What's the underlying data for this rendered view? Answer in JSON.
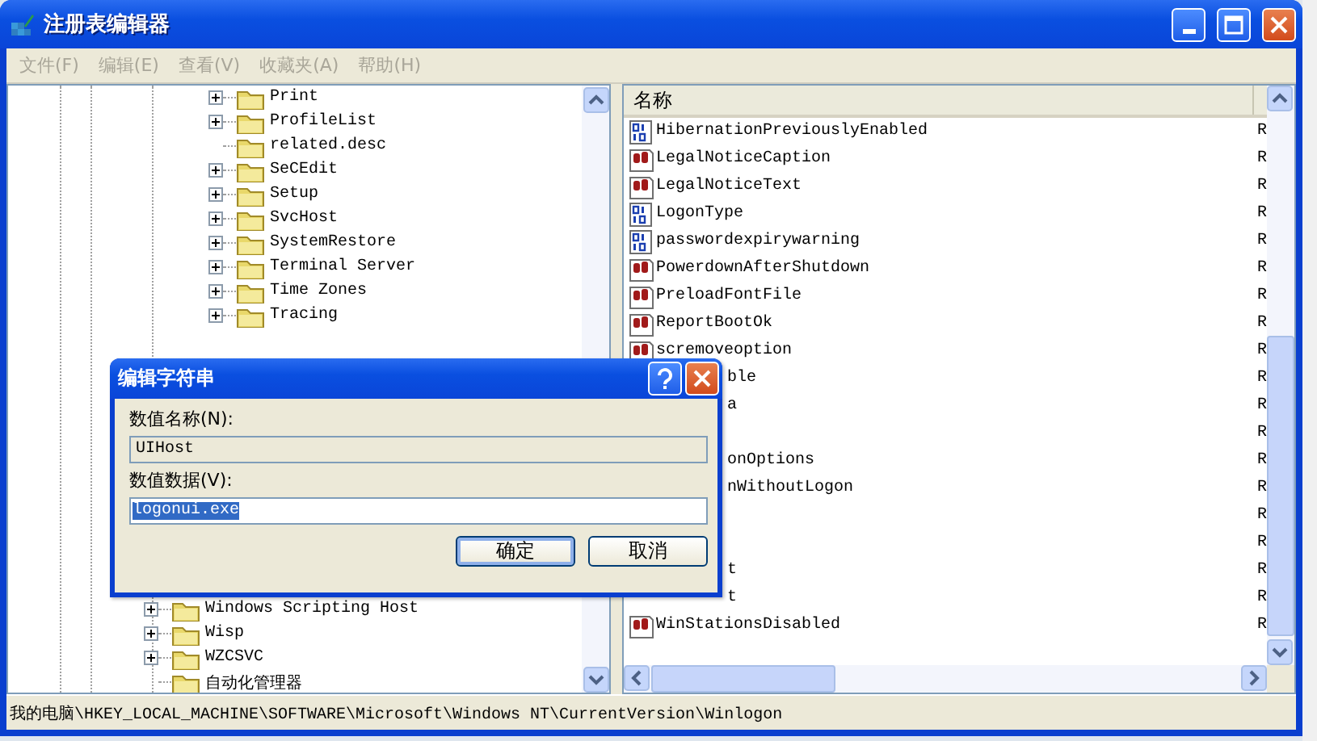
{
  "window": {
    "title": "注册表编辑器"
  },
  "menu": [
    {
      "label": "文件(F)",
      "disabled": true
    },
    {
      "label": "编辑(E)",
      "disabled": true
    },
    {
      "label": "查看(V)",
      "disabled": true
    },
    {
      "label": "收藏夹(A)",
      "disabled": true
    },
    {
      "label": "帮助(H)",
      "disabled": true
    }
  ],
  "tree": {
    "items": [
      {
        "children": [
          {
            "children": [
              {
                "label": "Print",
                "kind": "branch",
                "expanded": false
              },
              {
                "label": "ProfileList",
                "kind": "branch",
                "expanded": false
              },
              {
                "label": "related.desc",
                "kind": "leaf"
              },
              {
                "label": "SeCEdit",
                "kind": "branch",
                "expanded": false
              },
              {
                "label": "Setup",
                "kind": "branch",
                "expanded": false
              },
              {
                "label": "SvcHost",
                "kind": "branch",
                "expanded": false
              },
              {
                "label": "SystemRestore",
                "kind": "branch",
                "expanded": false
              },
              {
                "label": "Terminal Server",
                "kind": "branch",
                "expanded": false
              },
              {
                "label": "Time Zones",
                "kind": "branch",
                "expanded": false
              },
              {
                "label": "Tracing",
                "kind": "branch",
                "expanded": false
              }
            ]
          }
        ]
      },
      {
        "label": "Windows Scripting Host",
        "kind": "branch",
        "expanded": false
      },
      {
        "label": "Wisp",
        "kind": "branch",
        "expanded": false
      },
      {
        "label": "WZCSVC",
        "kind": "branch",
        "expanded": false
      },
      {
        "label": "自动化管理器",
        "kind": "leaf"
      }
    ]
  },
  "values": {
    "columns": [
      "名称"
    ],
    "rows": [
      {
        "name": "HibernationPreviouslyEnabled",
        "kind": "binary",
        "column_2": "R"
      },
      {
        "name": "LegalNoticeCaption",
        "kind": "string",
        "column_2": "R"
      },
      {
        "name": "LegalNoticeText",
        "kind": "string",
        "column_2": "R"
      },
      {
        "name": "LogonType",
        "kind": "binary",
        "column_2": "R"
      },
      {
        "name": "passwordexpirywarning",
        "kind": "binary",
        "column_2": "R"
      },
      {
        "name": "PowerdownAfterShutdown",
        "kind": "string",
        "column_2": "R"
      },
      {
        "name": "PreloadFontFile",
        "kind": "string",
        "column_2": "R"
      },
      {
        "name": "ReportBootOk",
        "kind": "string",
        "column_2": "R"
      },
      {
        "name": "scremoveoption",
        "kind": "string",
        "column_2": "R"
      },
      {
        "name": "ble",
        "kind": "covered",
        "column_2": "R"
      },
      {
        "name": "a",
        "kind": "covered",
        "column_2": "R"
      },
      {
        "kind": "covered",
        "column_2": "R"
      },
      {
        "name": "onOptions",
        "kind": "covered",
        "column_2": "R"
      },
      {
        "name": "nWithoutLogon",
        "kind": "covered",
        "column_2": "R"
      },
      {
        "kind": "covered",
        "column_2": "R"
      },
      {
        "kind": "covered",
        "column_2": "R"
      },
      {
        "name": "t",
        "kind": "covered",
        "column_2": "R"
      },
      {
        "name": "t",
        "kind": "covered",
        "column_2": "R"
      },
      {
        "name": "WinStationsDisabled",
        "kind": "string",
        "column_2": "R"
      }
    ]
  },
  "dialog": {
    "title": "编辑字符串",
    "name_label": "数值名称(N):",
    "name_value": "UIHost",
    "data_label": "数值数据(V):",
    "data_value": "logonui.exe",
    "buttons": [
      {
        "label": "确定",
        "default": true
      },
      {
        "label": "取消",
        "default": false
      }
    ]
  },
  "status_bar": "我的电脑\\HKEY_LOCAL_MACHINE\\SOFTWARE\\Microsoft\\Windows NT\\CurrentVersion\\Winlogon"
}
